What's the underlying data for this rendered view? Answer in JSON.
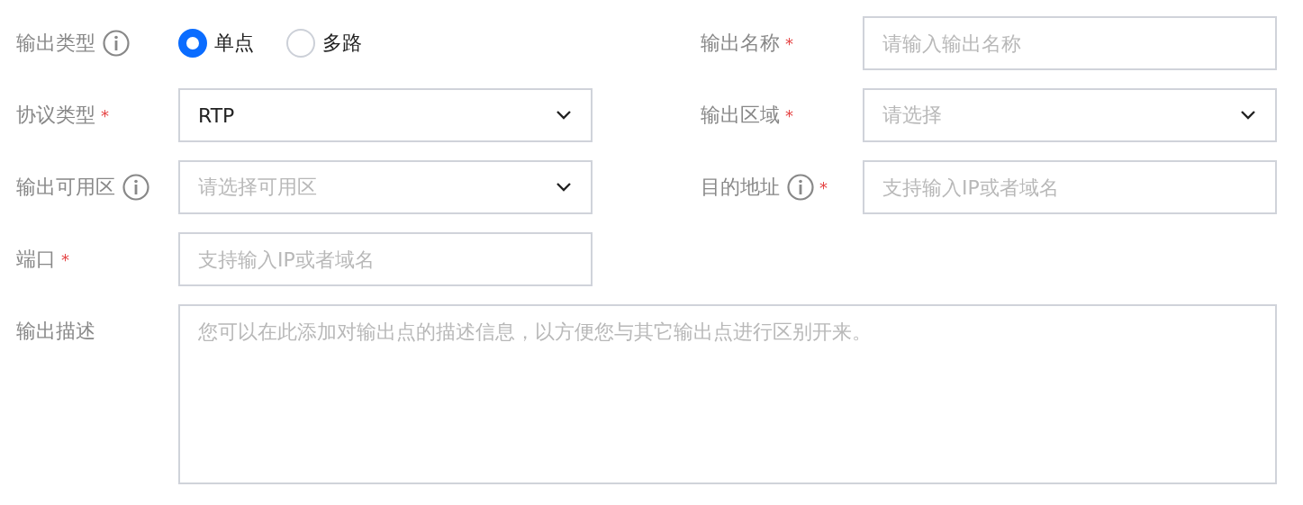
{
  "rows": [
    {
      "fields": [
        {
          "label": "输出类型",
          "info": true,
          "kind": "radio",
          "options": [
            {
              "label": "单点",
              "selected": true
            },
            {
              "label": "多路",
              "selected": false
            }
          ]
        },
        {
          "label": "输出名称",
          "required_mark": "*",
          "kind": "input",
          "placeholder": "请输入输出名称"
        }
      ]
    },
    {
      "fields": [
        {
          "label": "协议类型",
          "required_mark": "*",
          "kind": "select",
          "value": "RTP"
        },
        {
          "label": "输出区域",
          "required_mark": "*",
          "kind": "select",
          "placeholder": "请选择"
        }
      ]
    },
    {
      "fields": [
        {
          "label": "输出可用区",
          "info": true,
          "kind": "select",
          "placeholder": "请选择可用区"
        },
        {
          "label": "目的地址",
          "info": true,
          "required_mark": "*",
          "kind": "input",
          "placeholder": "支持输入IP或者域名"
        }
      ]
    },
    {
      "fields": [
        {
          "label": "端口",
          "required_mark": "*",
          "kind": "input",
          "placeholder": "支持输入IP或者域名"
        }
      ]
    },
    {
      "fields": [
        {
          "label": "输出描述",
          "kind": "textarea",
          "placeholder": "您可以在此添加对输出点的描述信息，以方便您与其它输出点进行区别开来。"
        }
      ]
    }
  ]
}
